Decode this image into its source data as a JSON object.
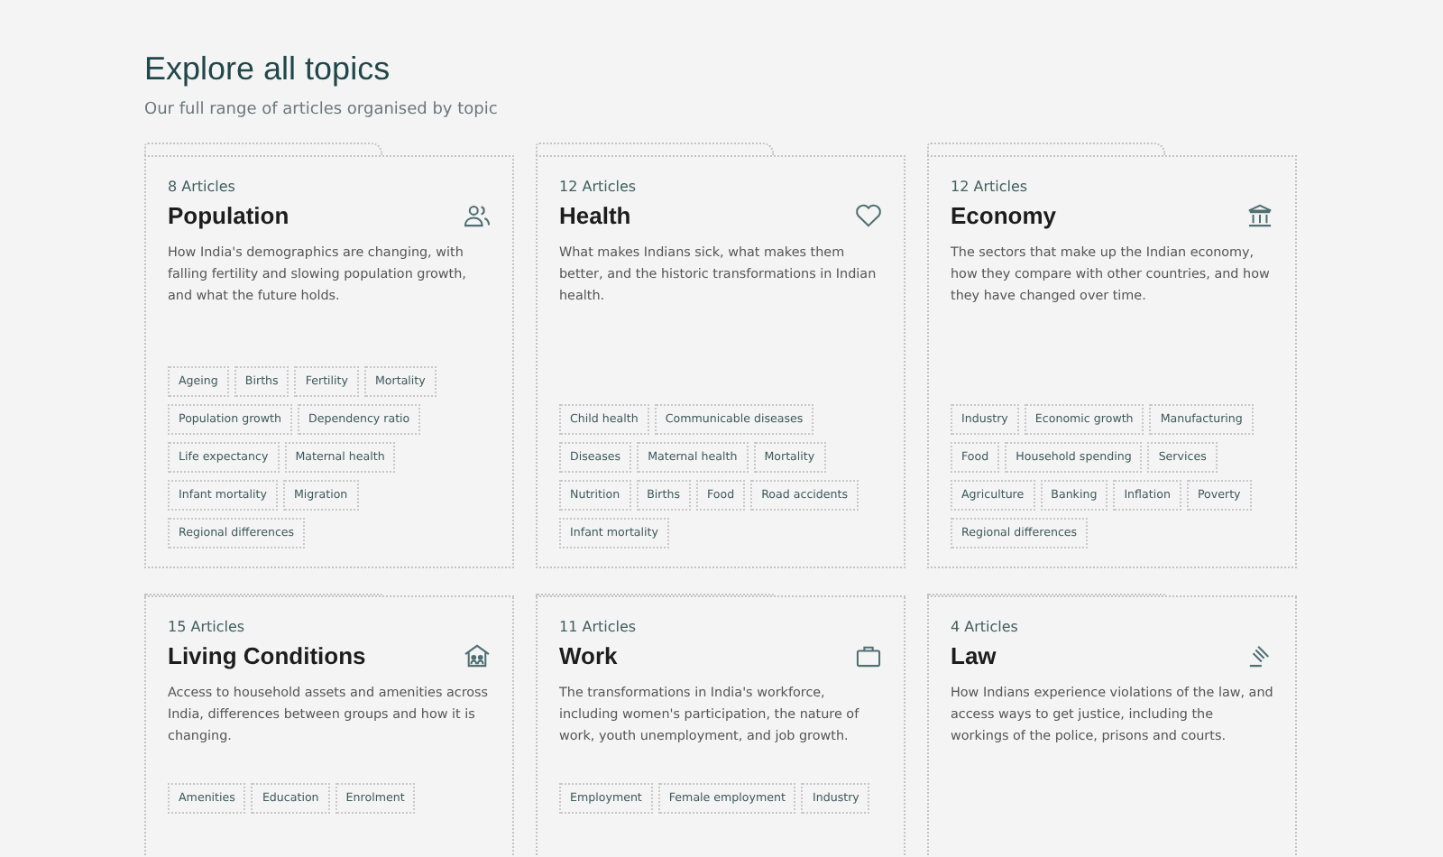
{
  "header": {
    "title": "Explore all topics",
    "subtitle": "Our full range of articles organised by topic"
  },
  "topics": [
    {
      "count": "8 Articles",
      "title": "Population",
      "description": "How India's demographics are changing, with falling fertility and slowing population growth, and what the future holds.",
      "tags": [
        "Ageing",
        "Births",
        "Fertility",
        "Mortality",
        "Population growth",
        "Dependency ratio",
        "Life expectancy",
        "Maternal health",
        "Infant mortality",
        "Migration",
        "Regional differences"
      ]
    },
    {
      "count": "12 Articles",
      "title": "Health",
      "description": "What makes Indians sick, what makes them better, and the historic transformations in Indian health.",
      "tags": [
        "Child health",
        "Communicable diseases",
        "Diseases",
        "Maternal health",
        "Mortality",
        "Nutrition",
        "Births",
        "Food",
        "Road accidents",
        "Infant mortality"
      ]
    },
    {
      "count": "12 Articles",
      "title": "Economy",
      "description": "The sectors that make up the Indian economy, how they compare with other countries, and how they have changed over time.",
      "tags": [
        "Industry",
        "Economic growth",
        "Manufacturing",
        "Food",
        "Household spending",
        "Services",
        "Agriculture",
        "Banking",
        "Inflation",
        "Poverty",
        "Regional differences"
      ]
    },
    {
      "count": "15 Articles",
      "title": "Living Conditions",
      "description": "Access to household assets and amenities across India, differences between groups and how it is changing.",
      "tags": [
        "Amenities",
        "Education",
        "Enrolment"
      ]
    },
    {
      "count": "11 Articles",
      "title": "Work",
      "description": "The transformations in India's workforce, including women's participation, the nature of work, youth unemployment, and job growth.",
      "tags": [
        "Employment",
        "Female employment",
        "Industry"
      ]
    },
    {
      "count": "4 Articles",
      "title": "Law",
      "description": "How Indians experience violations of the law, and access ways to get justice, including the workings of the police, prisons and courts."
    }
  ]
}
